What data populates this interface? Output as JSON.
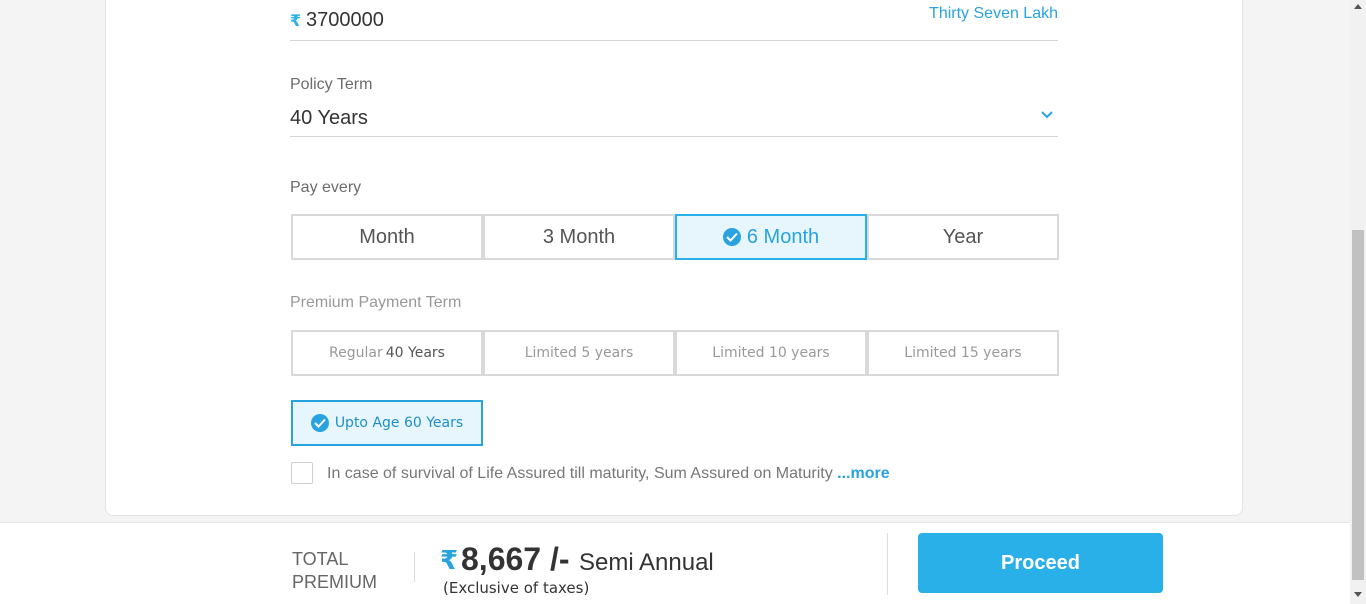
{
  "sum_assured": {
    "currency_symbol": "₹",
    "value": "3700000",
    "in_words": "Thirty Seven Lakh"
  },
  "policy_term": {
    "label": "Policy Term",
    "value": "40 Years",
    "chevron_icon": "chevron-down-icon"
  },
  "pay_every": {
    "label": "Pay every",
    "options": [
      "Month",
      "3 Month",
      "6 Month",
      "Year"
    ],
    "selected": "6 Month"
  },
  "premium_payment_term": {
    "label": "Premium Payment Term",
    "options": [
      {
        "prefix": "Regular",
        "value": "40 Years"
      },
      {
        "prefix": "Limited 5 years",
        "value": ""
      },
      {
        "prefix": "Limited 10 years",
        "value": ""
      },
      {
        "prefix": "Limited 15 years",
        "value": ""
      }
    ],
    "upto_age": "Upto Age 60 Years"
  },
  "maturity": {
    "text": "In case of survival of Life Assured till maturity, Sum Assured on Maturity ",
    "more": "...more"
  },
  "footer": {
    "total_line1": "TOTAL",
    "total_line2": "PREMIUM",
    "currency_symbol": "₹",
    "amount": "8,667 /-",
    "mode": "Semi Annual",
    "tax_note": "(Exclusive of taxes)",
    "proceed_label": "Proceed"
  },
  "colors": {
    "accent": "#29b0e8",
    "accent_text": "#29a3df"
  }
}
